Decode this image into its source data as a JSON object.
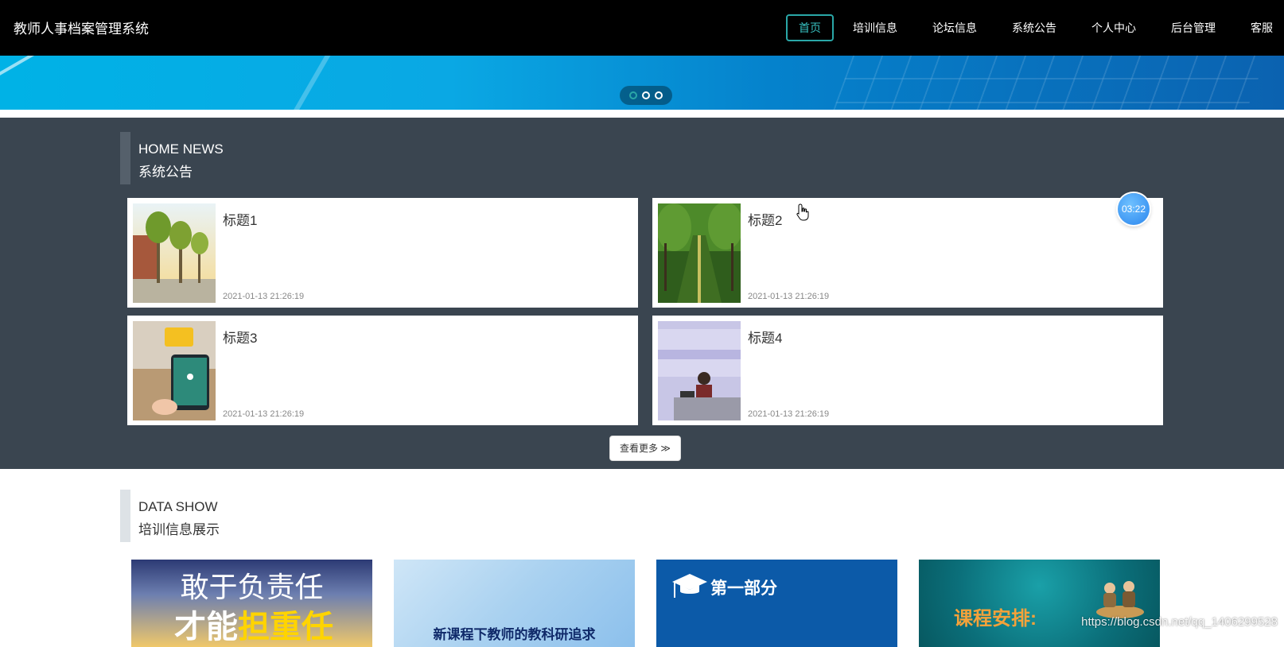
{
  "app": {
    "title": "教师人事档案管理系统"
  },
  "nav": {
    "items": [
      {
        "label": "首页",
        "active": true
      },
      {
        "label": "培训信息"
      },
      {
        "label": "论坛信息"
      },
      {
        "label": "系统公告"
      },
      {
        "label": "个人中心"
      },
      {
        "label": "后台管理"
      },
      {
        "label": "客服"
      }
    ]
  },
  "carousel": {
    "slide_count": 3,
    "active_index": 0
  },
  "news": {
    "title_en": "HOME NEWS",
    "title_cn": "系统公告",
    "items": [
      {
        "title": "标题1",
        "date": "2021-01-13 21:26:19",
        "image": "campus-trees-photo"
      },
      {
        "title": "标题2",
        "date": "2021-01-13 21:26:19",
        "image": "tree-lined-path-photo"
      },
      {
        "title": "标题3",
        "date": "2021-01-13 21:26:19",
        "image": "tablet-classroom-photo"
      },
      {
        "title": "标题4",
        "date": "2021-01-13 21:26:19",
        "image": "teacher-conference-photo"
      }
    ],
    "more_label": "查看更多"
  },
  "timer": {
    "label": "03:22"
  },
  "data_show": {
    "title_en": "DATA SHOW",
    "title_cn": "培训信息展示",
    "items": [
      {
        "text_line1": "敢于负责任",
        "text_line2a": "才能",
        "text_line2b": "担重任"
      },
      {
        "text": "新课程下教师的教科研追求"
      },
      {
        "text": "第一部分"
      },
      {
        "text": "课程安排:"
      }
    ]
  },
  "watermark": "https://blog.csdn.net/qq_1406299528",
  "colors": {
    "topbar_bg": "#000000",
    "accent": "#2aa7a7",
    "news_section_bg": "#3a4550"
  }
}
